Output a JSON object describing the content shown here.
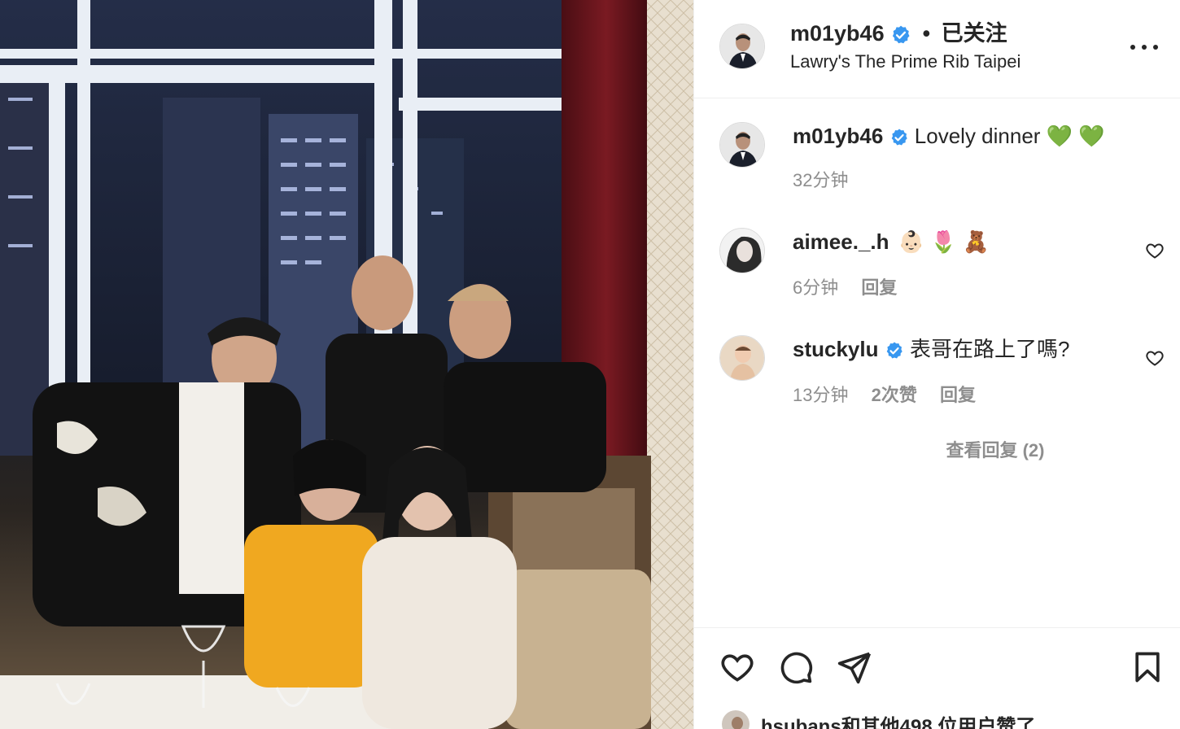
{
  "post": {
    "author": "m01yb46",
    "follow_status": "已关注",
    "separator": "•",
    "location": "Lawry's The Prime Rib Taipei",
    "verified_color": "#3897f0"
  },
  "caption": {
    "author": "m01yb46",
    "text": "Lovely dinner 💚 💚",
    "time": "32分钟"
  },
  "comments": [
    {
      "user": "aimee._.h",
      "text": "👶🏻 🌷 🧸",
      "time": "6分钟",
      "likes": "",
      "reply": "回复",
      "verified": false
    },
    {
      "user": "stuckylu",
      "text": "表哥在路上了嗎?",
      "time": "13分钟",
      "likes": "2次赞",
      "reply": "回复",
      "verified": true
    }
  ],
  "view_replies": "查看回复 (2)",
  "likes_text": "hsubans和其他498 位用户赞了",
  "icons": {
    "like": "heart-icon",
    "comment": "comment-icon",
    "share": "paper-plane-icon",
    "save": "bookmark-icon",
    "more": "more-options-icon",
    "verified": "verified-badge-icon"
  },
  "colors": {
    "text": "#262626",
    "secondary": "#8e8e8e",
    "border": "#efefef"
  }
}
